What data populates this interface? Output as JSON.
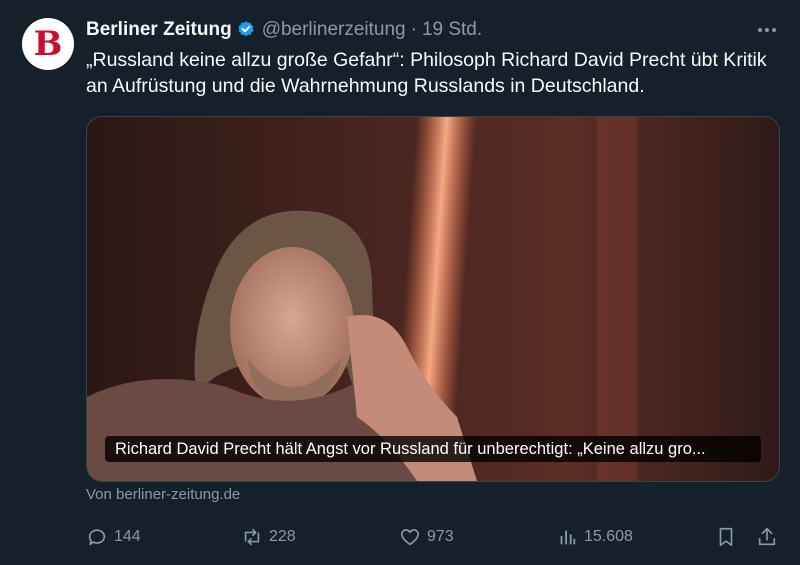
{
  "account": {
    "avatar_letter": "B",
    "name": "Berliner Zeitung",
    "handle": "@berlinerzeitung",
    "separator": "·",
    "time": "19 Std.",
    "verified_color": "#1d9bf0"
  },
  "tweet": {
    "text": "„Russland keine allzu große Gefahr“: Philosoph Richard David Precht übt Kritik an Aufrüstung und die Wahrnehmung Russlands in Deutschland."
  },
  "card": {
    "caption": "Richard David Precht hält Angst vor Russland für unberechtigt: „Keine allzu gro...",
    "source": "Von berliner-zeitung.de"
  },
  "actions": {
    "replies": "144",
    "reposts": "228",
    "likes": "973",
    "views": "15.608"
  },
  "icons": {
    "more": "more-icon",
    "reply": "reply-icon",
    "repost": "repost-icon",
    "like": "heart-icon",
    "views": "views-icon",
    "bookmark": "bookmark-icon",
    "share": "share-icon"
  }
}
